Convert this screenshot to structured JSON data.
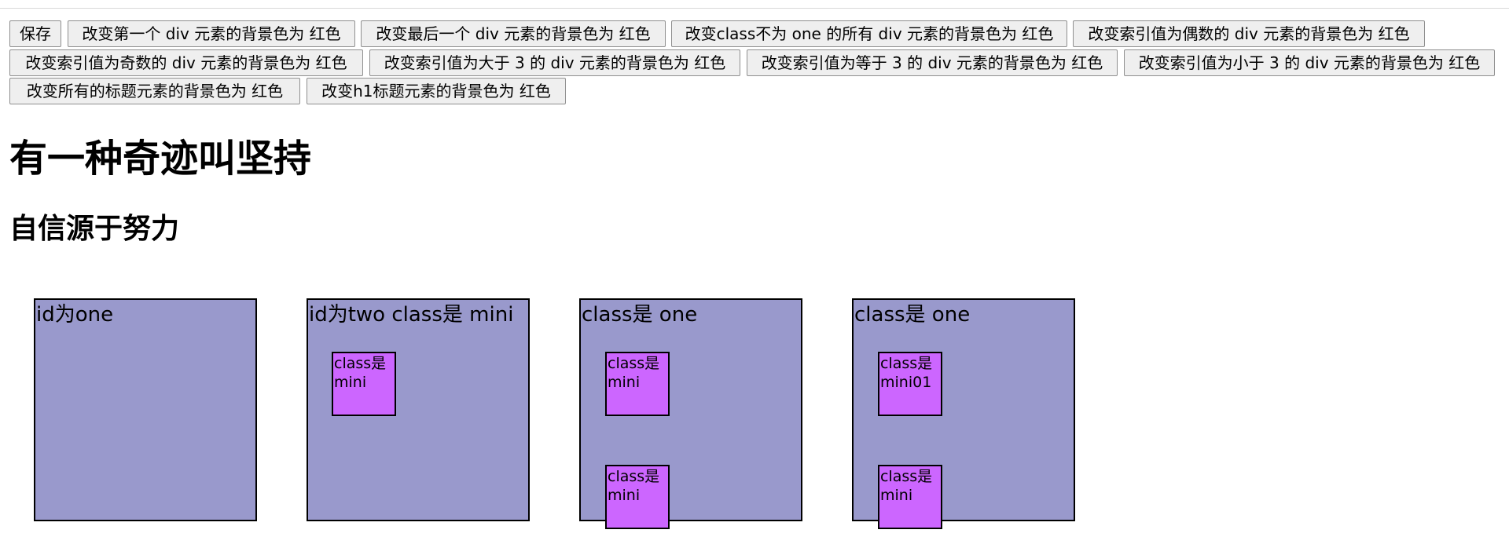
{
  "buttons": [
    "保存",
    "改变第一个 div 元素的背景色为 红色",
    "改变最后一个 div 元素的背景色为 红色",
    "改变class不为 one 的所有 div 元素的背景色为 红色",
    "改变索引值为偶数的 div 元素的背景色为 红色",
    "改变索引值为奇数的 div 元素的背景色为 红色",
    "改变索引值为大于 3 的 div 元素的背景色为 红色",
    "改变索引值为等于 3 的 div 元素的背景色为 红色",
    "改变索引值为小于 3 的 div 元素的背景色为 红色",
    "改变所有的标题元素的背景色为 红色",
    "改变h1标题元素的背景色为 红色"
  ],
  "headings": {
    "h1": "有一种奇迹叫坚持",
    "h2": "自信源于努力"
  },
  "boxes": [
    {
      "text": "id为one",
      "minis": []
    },
    {
      "text": "id为two class是 mini",
      "minis": [
        "class是 mini"
      ]
    },
    {
      "text": "class是 one",
      "minis": [
        "class是 mini",
        "class是 mini"
      ]
    },
    {
      "text": "class是 one",
      "minis": [
        "class是 mini01",
        "class是 mini"
      ]
    }
  ],
  "colors": {
    "box_background": "#9999cc",
    "mini_background": "#cc66ff",
    "border": "#000000",
    "button_background": "#efefef"
  }
}
